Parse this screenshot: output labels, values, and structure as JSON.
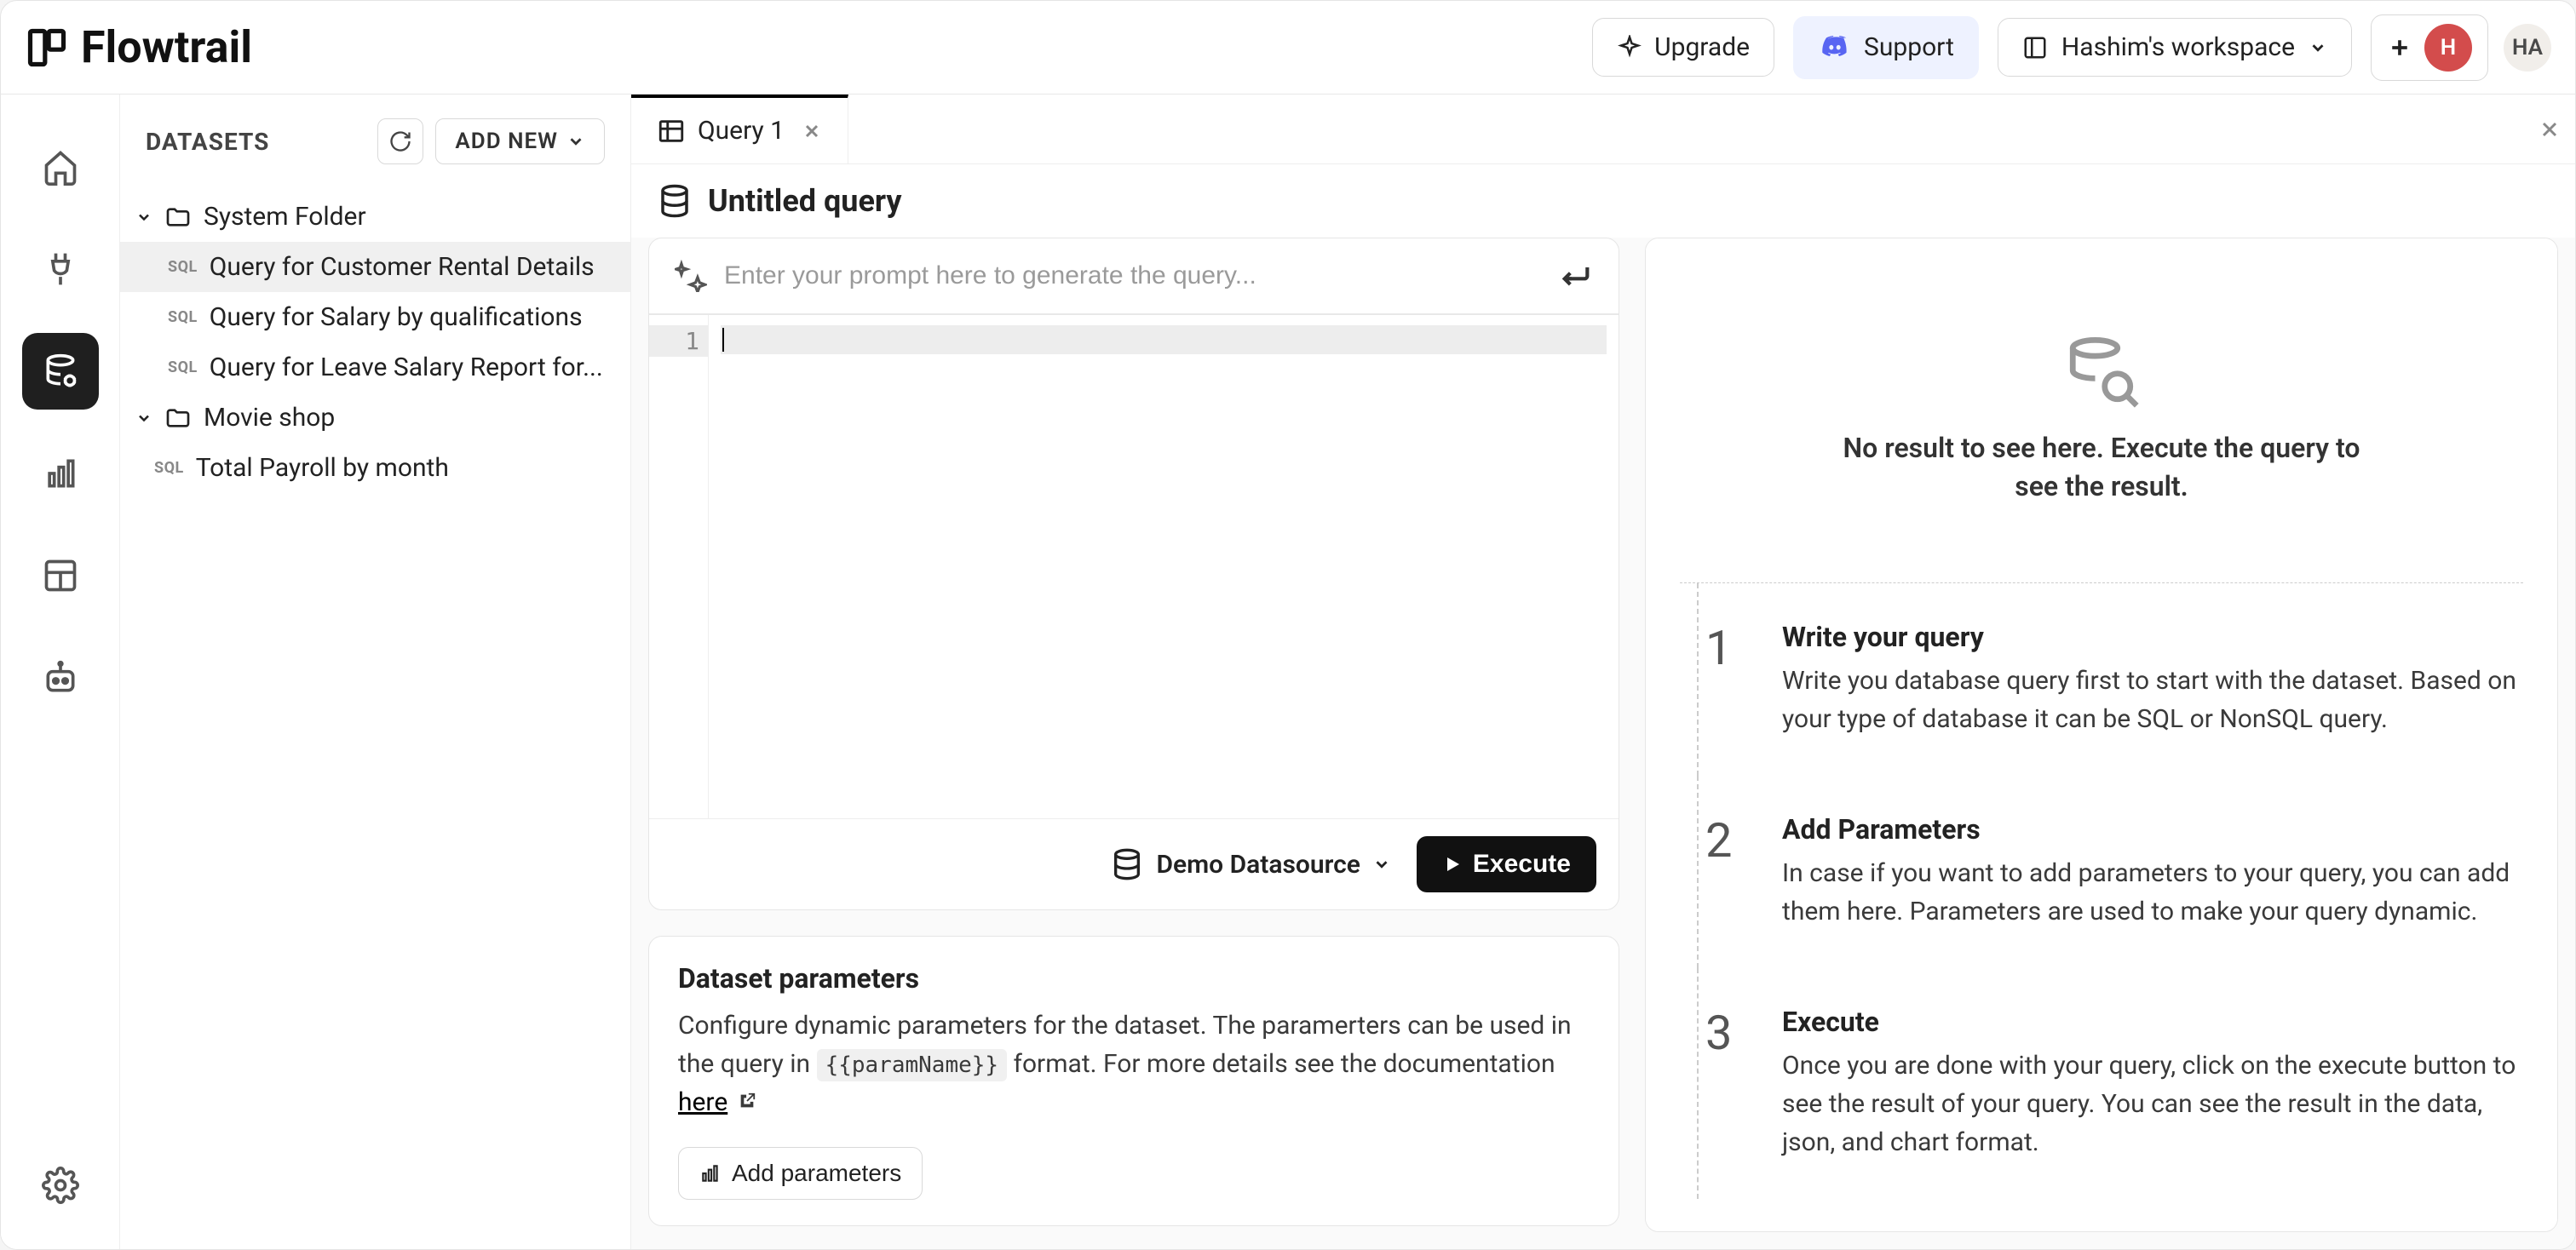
{
  "brand": "Flowtrail",
  "topbar": {
    "upgrade": "Upgrade",
    "support": "Support",
    "workspace": "Hashim's workspace",
    "avatar1": "H",
    "avatar2": "HA"
  },
  "sidebar": {
    "header": "DATASETS",
    "add_new": "ADD NEW",
    "folders": [
      {
        "name": "System Folder",
        "items": [
          "Query for Customer Rental Details",
          "Query for Salary by qualifications",
          "Query for Leave Salary Report for..."
        ]
      },
      {
        "name": "Movie shop",
        "items": []
      }
    ],
    "root_items": [
      "Total Payroll by month"
    ]
  },
  "tabs": [
    {
      "label": "Query 1",
      "active": true
    }
  ],
  "title": "Untitled query",
  "prompt_placeholder": "Enter your prompt here to generate the query...",
  "editor": {
    "gutter_line": "1",
    "datasource": "Demo Datasource",
    "execute": "Execute"
  },
  "params": {
    "title": "Dataset parameters",
    "desc_pre": "Configure dynamic parameters for the dataset. The paramerters can be used in the query in ",
    "code": "{{paramName}}",
    "desc_mid": " format. For more details see the documentation ",
    "link": "here",
    "add_btn": "Add parameters"
  },
  "results": {
    "empty": "No result to see here. Execute the query to see the result.",
    "steps": [
      {
        "num": "1",
        "title": "Write your query",
        "desc": "Write you database query first to start with the dataset. Based on your type of database it can be SQL or NonSQL query."
      },
      {
        "num": "2",
        "title": "Add Parameters",
        "desc": "In case if you want to add parameters to your query, you can add them here. Parameters are used to make your query dynamic."
      },
      {
        "num": "3",
        "title": "Execute",
        "desc": "Once you are done with your query, click on the execute button to see the result of your query. You can see the result in the data, json, and chart format."
      }
    ]
  }
}
